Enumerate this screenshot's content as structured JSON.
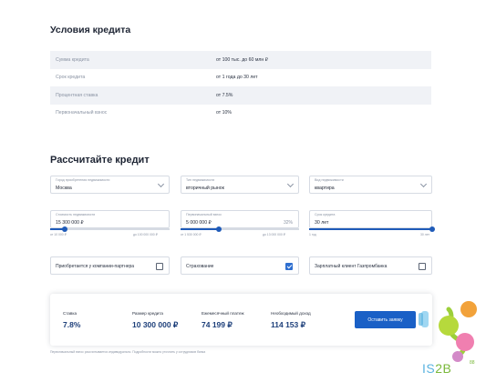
{
  "terms": {
    "title": "Условия кредита",
    "rows": [
      {
        "label": "Сумма кредита",
        "value": "от 100 тыс. до 60 млн ₽"
      },
      {
        "label": "Срок кредита",
        "value": "от 1 года до 30 лет"
      },
      {
        "label": "Процентная ставка",
        "value": "от 7.5%"
      },
      {
        "label": "Первоначальный взнос",
        "value": "от 10%"
      }
    ]
  },
  "calc": {
    "title": "Рассчитайте кредит",
    "city": {
      "label": "Город приобретения недвижимости",
      "value": "Москва"
    },
    "market": {
      "label": "Тип недвижимости",
      "value": "вторичный рынок"
    },
    "property": {
      "label": "Вид недвижимости",
      "value": "квартира"
    },
    "cost": {
      "label": "Стоимость недвижимости",
      "value": "15 300 000 ₽",
      "min": "от 10 000 ₽",
      "max": "до 100 000 000 ₽",
      "position": 0.12
    },
    "down": {
      "label": "Первоначальный взнос",
      "value": "5 000 000 ₽",
      "pct": "32%",
      "min": "от 1 530 000 ₽",
      "max": "до 13 000 000 ₽",
      "position": 0.32
    },
    "term": {
      "label": "Срок кредита",
      "value": "30 лет",
      "min": "1 год",
      "max": "30 лет",
      "position": 1.0
    },
    "checks": [
      {
        "label": "Приобретается у компании-партнера",
        "checked": false
      },
      {
        "label": "Страхование",
        "checked": true
      },
      {
        "label": "Зарплатный клиент Газпромбанка",
        "checked": false
      }
    ]
  },
  "result": {
    "rate": {
      "label": "Ставка",
      "value": "7.8%"
    },
    "amount": {
      "label": "Размер кредита",
      "value": "10 300 000 ₽"
    },
    "payment": {
      "label": "Ежемесячный платеж",
      "value": "74 199 ₽"
    },
    "income": {
      "label": "Необходимый доход",
      "value": "114 153 ₽"
    },
    "apply_label": "Оставить заявку"
  },
  "footnote": "Первоначальный взнос рассчитывается индивидуально. Подробности можно уточнить у сотрудников банка",
  "logo": {
    "text_a": "IS",
    "text_b": "2B",
    "sup": "88"
  },
  "colors": {
    "accent": "#1a60c6",
    "slider": "#1f5bb8",
    "result_value": "#1d3f7a"
  }
}
